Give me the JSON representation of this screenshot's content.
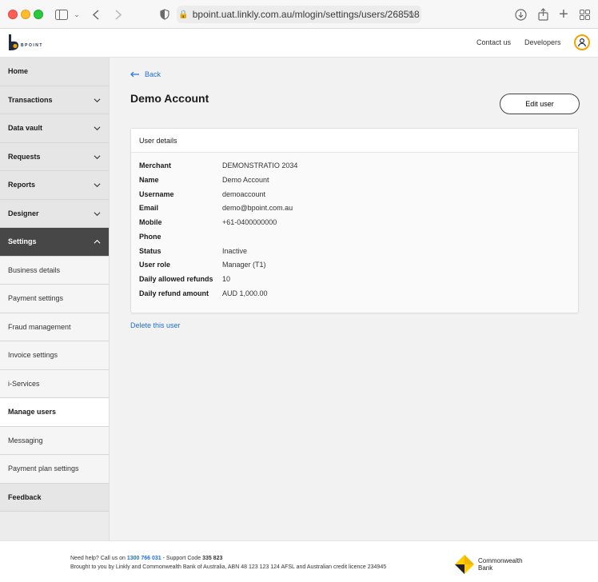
{
  "browser": {
    "url": "bpoint.uat.linkly.com.au/mlogin/settings/users/268518"
  },
  "header": {
    "logo_text": "BPOINT",
    "contact_label": "Contact us",
    "developers_label": "Developers"
  },
  "sidebar": {
    "items": [
      {
        "label": "Home"
      },
      {
        "label": "Transactions"
      },
      {
        "label": "Data vault"
      },
      {
        "label": "Requests"
      },
      {
        "label": "Reports"
      },
      {
        "label": "Designer"
      },
      {
        "label": "Settings"
      },
      {
        "label": "Business details"
      },
      {
        "label": "Payment settings"
      },
      {
        "label": "Fraud management"
      },
      {
        "label": "Invoice settings"
      },
      {
        "label": "i-Services"
      },
      {
        "label": "Manage users"
      },
      {
        "label": "Messaging"
      },
      {
        "label": "Payment plan settings"
      },
      {
        "label": "Feedback"
      }
    ]
  },
  "main": {
    "back_label": "Back",
    "title": "Demo Account",
    "edit_button": "Edit user",
    "card_title": "User details",
    "details": [
      {
        "label": "Merchant",
        "value": "DEMONSTRATIO 2034"
      },
      {
        "label": "Name",
        "value": "Demo Account"
      },
      {
        "label": "Username",
        "value": "demoaccount"
      },
      {
        "label": "Email",
        "value": "demo@bpoint.com.au"
      },
      {
        "label": "Mobile",
        "value": "+61-0400000000"
      },
      {
        "label": "Phone",
        "value": ""
      },
      {
        "label": "Status",
        "value": "Inactive"
      },
      {
        "label": "User role",
        "value": "Manager (T1)"
      },
      {
        "label": "Daily allowed refunds",
        "value": "10"
      },
      {
        "label": "Daily refund amount",
        "value": "AUD 1,000.00"
      }
    ],
    "delete_link": "Delete this user"
  },
  "footer": {
    "help_prefix": "Need help? Call us on",
    "phone": "1300 766 031",
    "support_text": "- Support Code",
    "support_code": "335 823",
    "legal": "Brought to you by Linkly and Commonwealth Bank of Australia, ABN 48 123 123 124 AFSL and Australian credit licence 234945",
    "bank_line1": "Commonwealth",
    "bank_line2": "Bank"
  },
  "colors": {
    "accent_link": "#1e6fd9",
    "active_nav": "#474747",
    "brand_orange": "#f0a500"
  }
}
